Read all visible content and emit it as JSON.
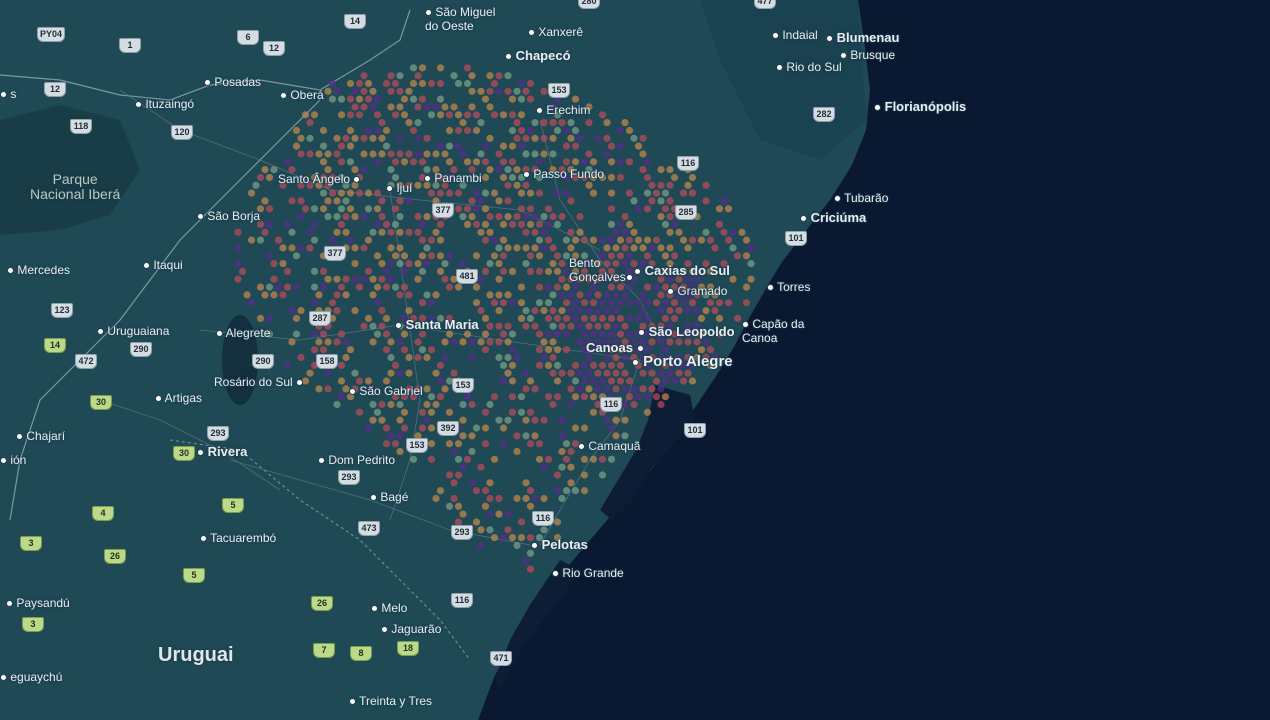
{
  "map": {
    "country_label": "Uruguai",
    "park_label": [
      "Parque",
      "Nacional Iberá"
    ],
    "places": [
      {
        "name": "São Miguel",
        "name2": "do Oeste",
        "size": "sm"
      },
      {
        "name": "Xanxerê",
        "size": "sm"
      },
      {
        "name": "Chapecó",
        "size": "md"
      },
      {
        "name": "Erechim",
        "size": "sm"
      },
      {
        "name": "Posadas",
        "size": "sm"
      },
      {
        "name": "Oberá",
        "size": "sm"
      },
      {
        "name": "Ituzaingó",
        "size": "sm"
      },
      {
        "name": "Santo Ângelo",
        "size": "sm"
      },
      {
        "name": "Ijuí",
        "size": "sm"
      },
      {
        "name": "Panambi",
        "size": "sm"
      },
      {
        "name": "Passo Fundo",
        "size": "sm"
      },
      {
        "name": "São Borja",
        "size": "sm"
      },
      {
        "name": "Itaqui",
        "size": "sm"
      },
      {
        "name": "Mercedes",
        "size": "sm"
      },
      {
        "name": "Uruguaiana",
        "size": "sm"
      },
      {
        "name": "Alegrete",
        "size": "sm"
      },
      {
        "name": "Santa Maria",
        "size": "md"
      },
      {
        "name": "Bento",
        "name2": "Gonçalves",
        "size": "sm"
      },
      {
        "name": "Caxias do Sul",
        "size": "md"
      },
      {
        "name": "Gramado",
        "size": "sm"
      },
      {
        "name": "São Leopoldo",
        "size": "md"
      },
      {
        "name": "Canoas",
        "size": "md"
      },
      {
        "name": "Porto Alegre",
        "size": "lg"
      },
      {
        "name": "Torres",
        "size": "sm"
      },
      {
        "name": "Capão da",
        "name2": "Canoa",
        "size": "sm"
      },
      {
        "name": "Rosário do Sul",
        "size": "sm"
      },
      {
        "name": "São Gabriel",
        "size": "sm"
      },
      {
        "name": "Artigas",
        "size": "sm"
      },
      {
        "name": "Chajarí",
        "size": "sm"
      },
      {
        "name": "Rivera",
        "size": "md"
      },
      {
        "name": "Dom Pedrito",
        "size": "sm"
      },
      {
        "name": "Bagé",
        "size": "sm"
      },
      {
        "name": "Camaquã",
        "size": "sm"
      },
      {
        "name": "Pelotas",
        "size": "md"
      },
      {
        "name": "Rio Grande",
        "size": "sm"
      },
      {
        "name": "Tacuarembó",
        "size": "sm"
      },
      {
        "name": "Paysandú",
        "size": "sm"
      },
      {
        "name": "Melo",
        "size": "sm"
      },
      {
        "name": "Jaguarão",
        "size": "sm"
      },
      {
        "name": "Treinta y Tres",
        "size": "sm"
      },
      {
        "name": "eguaychú",
        "size": "sm"
      },
      {
        "name": "ión",
        "size": "sm"
      },
      {
        "name": "Indaial",
        "size": "sm"
      },
      {
        "name": "Blumenau",
        "size": "md"
      },
      {
        "name": "Brusque",
        "size": "sm"
      },
      {
        "name": "Rio do Sul",
        "size": "sm"
      },
      {
        "name": "Florianópolis",
        "size": "md"
      },
      {
        "name": "Tubarão",
        "size": "sm"
      },
      {
        "name": "Criciúma",
        "size": "md"
      },
      {
        "name": "s",
        "size": "sm"
      }
    ],
    "roads": [
      "280",
      "477",
      "14",
      "PY04",
      "6",
      "12",
      "1",
      "12",
      "118",
      "120",
      "153",
      "116",
      "285",
      "282",
      "101",
      "377",
      "377",
      "481",
      "287",
      "290",
      "290",
      "158",
      "153",
      "116",
      "101",
      "392",
      "153",
      "293",
      "293",
      "473",
      "293",
      "116",
      "116",
      "471",
      "123",
      "472",
      "30",
      "30",
      "5",
      "4",
      "3",
      "26",
      "5",
      "26",
      "7",
      "8",
      "18",
      "3",
      "14",
      "4"
    ],
    "colors": {
      "land": "#1f4a55",
      "land_dark": "#183d47",
      "ocean": "#0b1831",
      "water": "#14303f",
      "road": "#5b7a85",
      "hex_orange": "#c98a4b",
      "hex_red": "#c04a5a",
      "hex_purple": "#5a2a8f"
    }
  }
}
